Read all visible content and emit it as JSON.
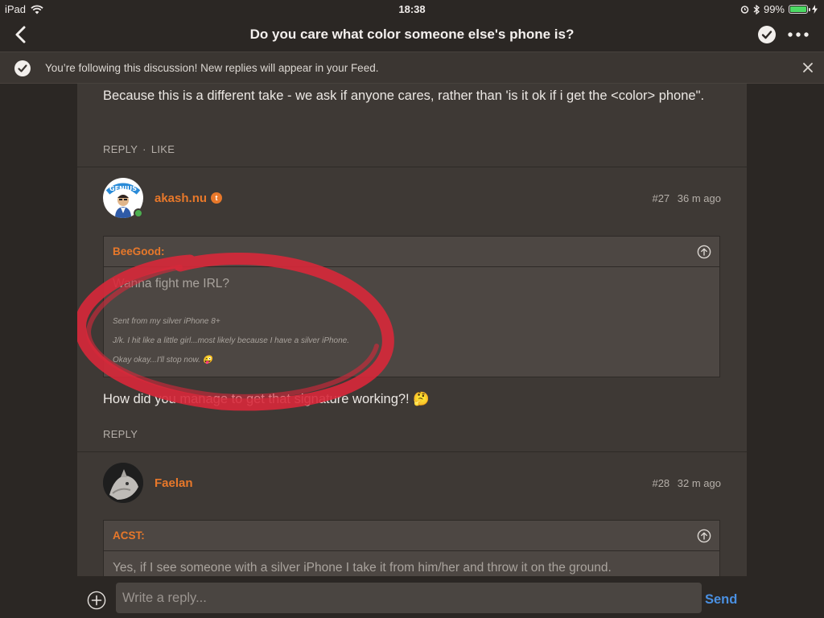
{
  "status": {
    "device": "iPad",
    "time": "18:38",
    "battery": "99%",
    "battery_level": 0.99
  },
  "nav": {
    "title": "Do you care what color someone else's phone is?"
  },
  "banner": {
    "text": "You’re following this discussion! New replies will appear in your Feed."
  },
  "post_top": {
    "text": "Because this is a different take - we ask if anyone cares, rather than 'is it ok if i get the <color> phone\".",
    "reply_label": "REPLY",
    "separator": "·",
    "like_label": "LIKE"
  },
  "post27": {
    "author": "akash.nu",
    "badge": "t",
    "number": "#27",
    "time": "36 m ago",
    "quote": {
      "name": "BeeGood:",
      "line1": "Wanna fight me IRL?",
      "line2": "Sent from my silver iPhone 8+",
      "line3": "J/k. I hit like a little girl...most likely because I have a silver iPhone.",
      "line4": "Okay okay...I'll stop now. 😜"
    },
    "text": "How did you manage to get that signature working?! 🤔",
    "reply_label": "REPLY"
  },
  "post28": {
    "author": "Faelan",
    "number": "#28",
    "time": "32 m ago",
    "quote": {
      "name": "ACST:",
      "line1": "Yes, if I see someone with a silver iPhone I take it from him/her and throw it on the ground."
    }
  },
  "reply": {
    "placeholder": "Write a reply...",
    "send_label": "Send"
  },
  "colors": {
    "accent": "#e8782a",
    "link": "#4a90e2",
    "annotation": "#d8283a"
  },
  "icons": [
    "wifi-icon",
    "alarm-icon",
    "bluetooth-icon",
    "battery-icon",
    "back-chevron-icon",
    "checkmark-circle-icon",
    "more-icon",
    "close-icon",
    "arrow-up-circle-icon",
    "plus-circle-icon"
  ]
}
